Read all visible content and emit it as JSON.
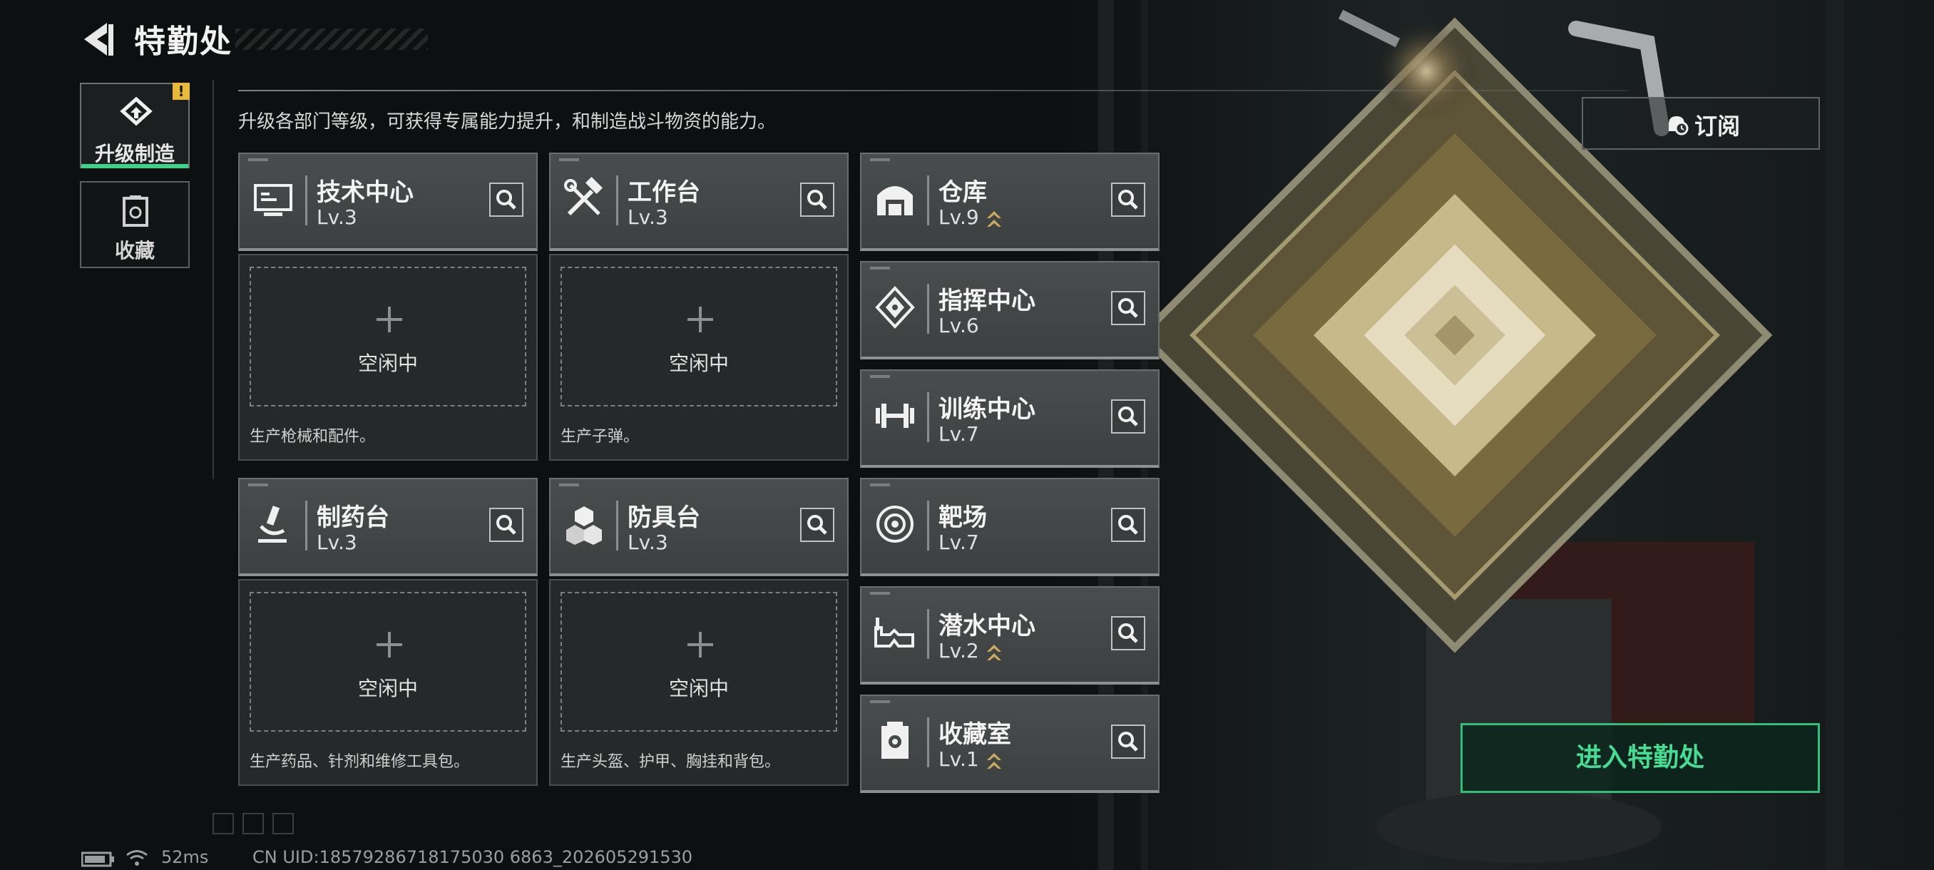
{
  "header": {
    "title": "特勤处"
  },
  "nav": {
    "tabs": [
      {
        "label": "升级制造",
        "active": true,
        "alert": "!"
      },
      {
        "label": "收藏",
        "active": false
      }
    ]
  },
  "description": "升级各部门等级，可获得专属能力提升，和制造战斗物资的能力。",
  "production_cards": [
    {
      "name": "技术中心",
      "level": "Lv.3",
      "icon": "monitor-icon",
      "status": "空闲中",
      "produces": "生产枪械和配件。"
    },
    {
      "name": "工作台",
      "level": "Lv.3",
      "icon": "wrench-hammer-icon",
      "status": "空闲中",
      "produces": "生产子弹。"
    },
    {
      "name": "制药台",
      "level": "Lv.3",
      "icon": "microscope-icon",
      "status": "空闲中",
      "produces": "生产药品、针剂和维修工具包。"
    },
    {
      "name": "防具台",
      "level": "Lv.3",
      "icon": "cubes-icon",
      "status": "空闲中",
      "produces": "生产头盔、护甲、胸挂和背包。"
    }
  ],
  "facilities": [
    {
      "name": "仓库",
      "level": "Lv.9",
      "icon": "warehouse-icon",
      "upgradable": true
    },
    {
      "name": "指挥中心",
      "level": "Lv.6",
      "icon": "command-chip-icon",
      "upgradable": false
    },
    {
      "name": "训练中心",
      "level": "Lv.7",
      "icon": "dumbbell-icon",
      "upgradable": false
    },
    {
      "name": "靶场",
      "level": "Lv.7",
      "icon": "target-icon",
      "upgradable": false
    },
    {
      "name": "潜水中心",
      "level": "Lv.2",
      "icon": "diving-mask-icon",
      "upgradable": true
    },
    {
      "name": "收藏室",
      "level": "Lv.1",
      "icon": "collection-case-icon",
      "upgradable": true
    }
  ],
  "subscribe": {
    "label": "订阅"
  },
  "enter_button": {
    "label": "进入特勤处"
  },
  "status_bar": {
    "ping": "52ms",
    "uid": "CN UID:18579286718175030 6863_202605291530"
  },
  "colors": {
    "accent_green": "#3fd28a",
    "alert_yellow": "#e8b93a",
    "card_bg": "#464949"
  }
}
